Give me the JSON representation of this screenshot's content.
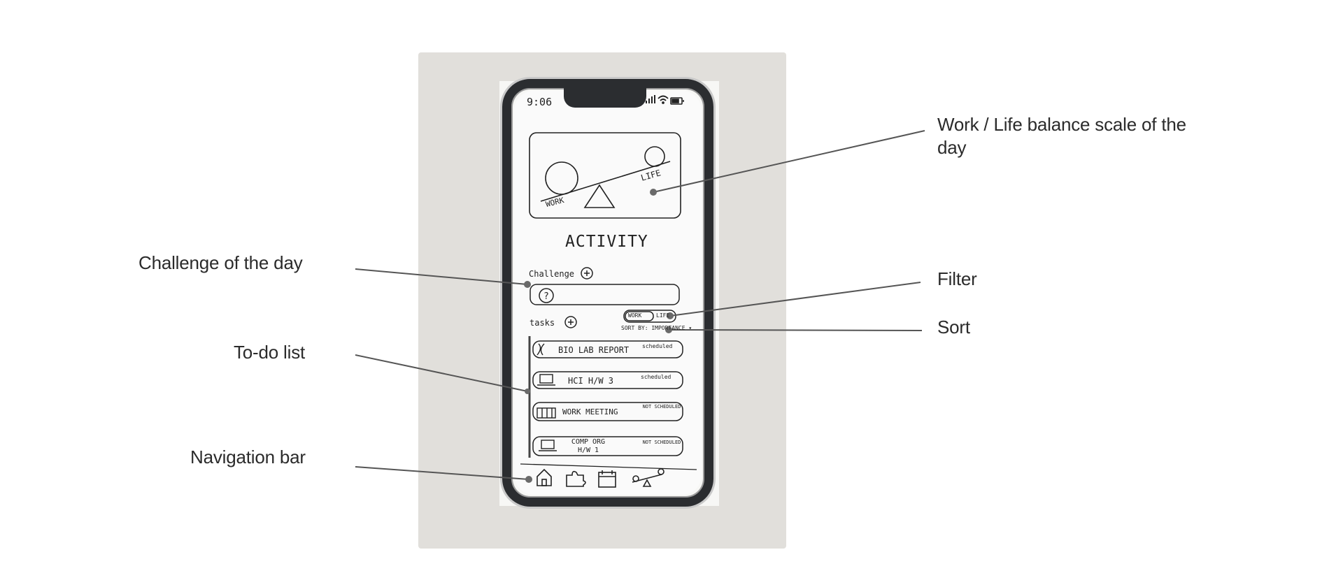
{
  "annotations": {
    "balance": "Work / Life balance scale of the day",
    "challenge": "Challenge of the day",
    "filter": "Filter",
    "sort": "Sort",
    "todo": "To-do list",
    "navbar": "Navigation bar"
  },
  "sketch": {
    "status_time": "9:06",
    "scale_work": "WORK",
    "scale_life": "LIFE",
    "title": "ACTIVITY",
    "challenge_label": "Challenge",
    "tasks_label": "tasks",
    "filter_work": "WORK",
    "filter_life": "LIFE",
    "sort_text": "SORT BY: IMPORTANCE ▾",
    "tasks": [
      {
        "name": "BIO LAB REPORT",
        "status": "scheduled",
        "icon": "dna-icon"
      },
      {
        "name": "HCI H/W 3",
        "status": "scheduled",
        "icon": "laptop-icon"
      },
      {
        "name": "WORK MEETING",
        "status": "NOT SCHEDULED",
        "icon": "meeting-icon"
      },
      {
        "name": "COMP ORG H/W 1",
        "status": "NOT SCHEDULED",
        "icon": "laptop-icon"
      }
    ],
    "nav_icons": [
      "home-icon",
      "puzzle-icon",
      "calendar-icon",
      "balance-icon"
    ]
  }
}
